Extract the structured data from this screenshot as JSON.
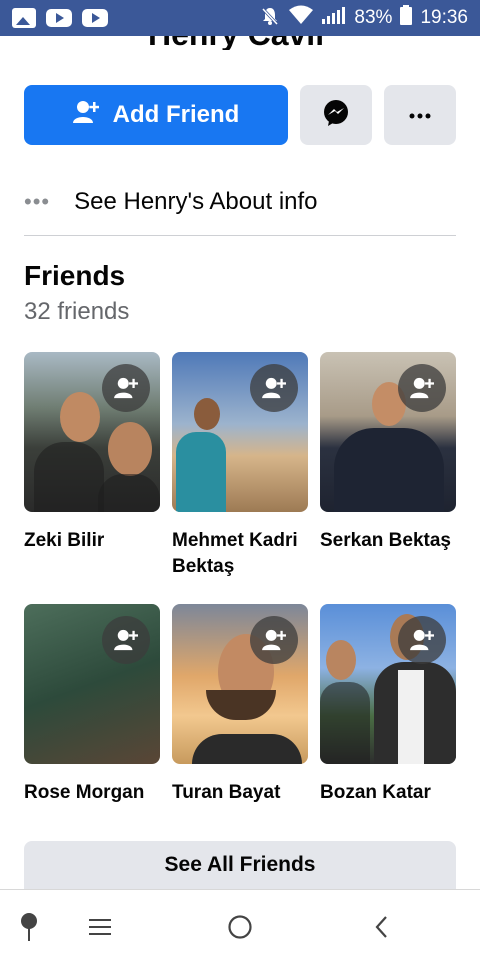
{
  "status_bar": {
    "battery": "83%",
    "time": "19:36",
    "icons": [
      "image-icon",
      "youtube-icon",
      "youtube-icon",
      "mute-icon",
      "wifi-icon",
      "signal-icon",
      "battery-icon"
    ]
  },
  "profile": {
    "name": "Henry Cavil"
  },
  "actions": {
    "add_friend_label": "Add Friend",
    "messenger_icon": "messenger-icon",
    "more_icon": "more-icon"
  },
  "about": {
    "dots": "•••",
    "label": "See Henry's About info"
  },
  "friends": {
    "title": "Friends",
    "count": "32 friends",
    "items": [
      {
        "name": "Zeki Bilir"
      },
      {
        "name": "Mehmet Kadri Bektaş"
      },
      {
        "name": "Serkan Bektaş"
      },
      {
        "name": "Rose Morgan"
      },
      {
        "name": "Turan Bayat"
      },
      {
        "name": "Bozan Katar"
      }
    ],
    "see_all_label": "See All Friends"
  },
  "nav": {
    "icons": [
      "pin-icon",
      "menu-icon",
      "home-icon",
      "back-icon"
    ]
  },
  "colors": {
    "accent": "#1877f2",
    "status_bar": "#3b5898",
    "secondary_button": "#e4e6eb"
  }
}
